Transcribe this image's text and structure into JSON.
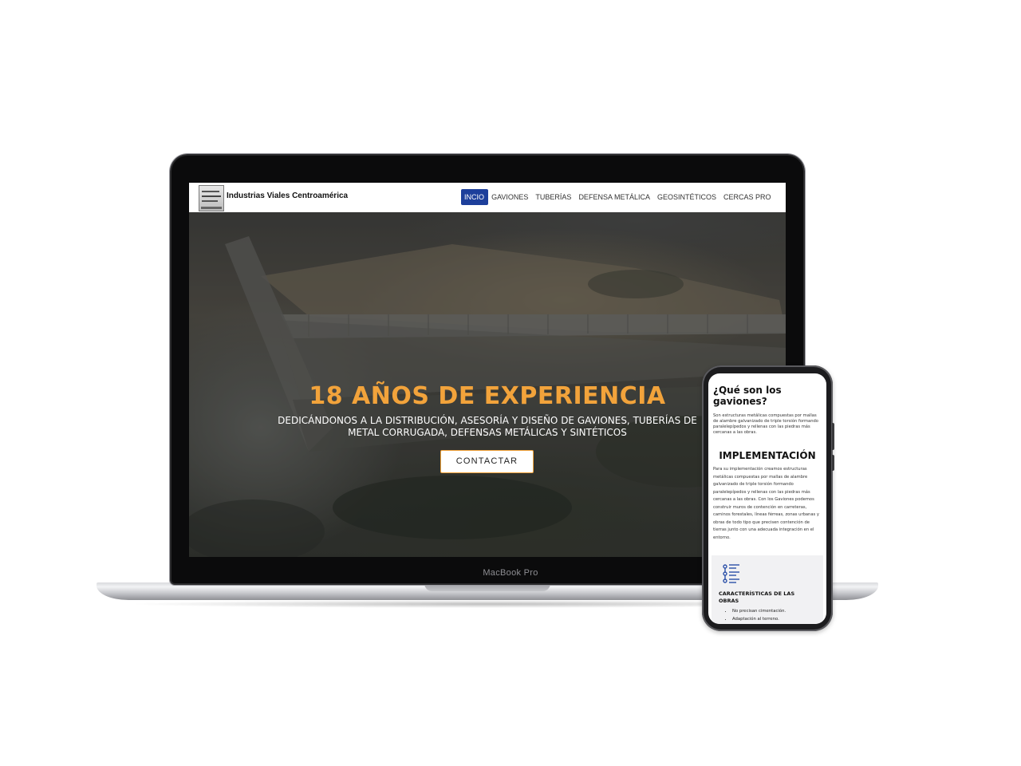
{
  "laptop": {
    "model_label": "MacBook Pro"
  },
  "site": {
    "name": "Industrias Viales Centroamérica",
    "nav": [
      "INCIO",
      "GAVIONES",
      "TUBERÍAS",
      "DEFENSA METÁLICA",
      "GEOSINTÉTICOS",
      "CERCAS PRO"
    ],
    "active_nav": "INCIO",
    "accent_color": "#f2a33b",
    "nav_active_color": "#1d3f9b"
  },
  "hero": {
    "title": "18 AÑOS DE EXPERIENCIA",
    "subtitle": "DEDICÁNDONOS A LA DISTRIBUCIÓN, ASESORÍA Y DISEÑO DE GAVIONES, TUBERÍAS DE METAL CORRUGADA, DEFENSAS METÁLICAS Y SINTÉTICOS",
    "cta_label": "CONTACTAR"
  },
  "mobile": {
    "heading": "¿Qué son los gaviones?",
    "intro": "Son estructuras metálicas compuestas por mallas de alambre galvanizado de triple torsión formando paralelepípedos y rellenas con las piedras más cercanas a las obras.",
    "section_title": "IMPLEMENTACIÓN",
    "section_text": "Para su implementación creamos estructuras metálicas compuestas por mallas de alambre galvanizado de triple torsión formando paralelepípedos y rellenas con las piedras más cercanas a las obras. Con los Gaviones podemos construir muros de contención en carreteras, caminos forestales, líneas férreas, zonas urbanas y obras de todo tipo que precisen contención de tierras junto con una adecuada integración en el entorno.",
    "card": {
      "icon": "list-icon",
      "title": "CARACTERÍSTICAS DE LAS OBRAS",
      "items": [
        "No precisan cimentación.",
        "Adaptación al terreno."
      ]
    }
  }
}
